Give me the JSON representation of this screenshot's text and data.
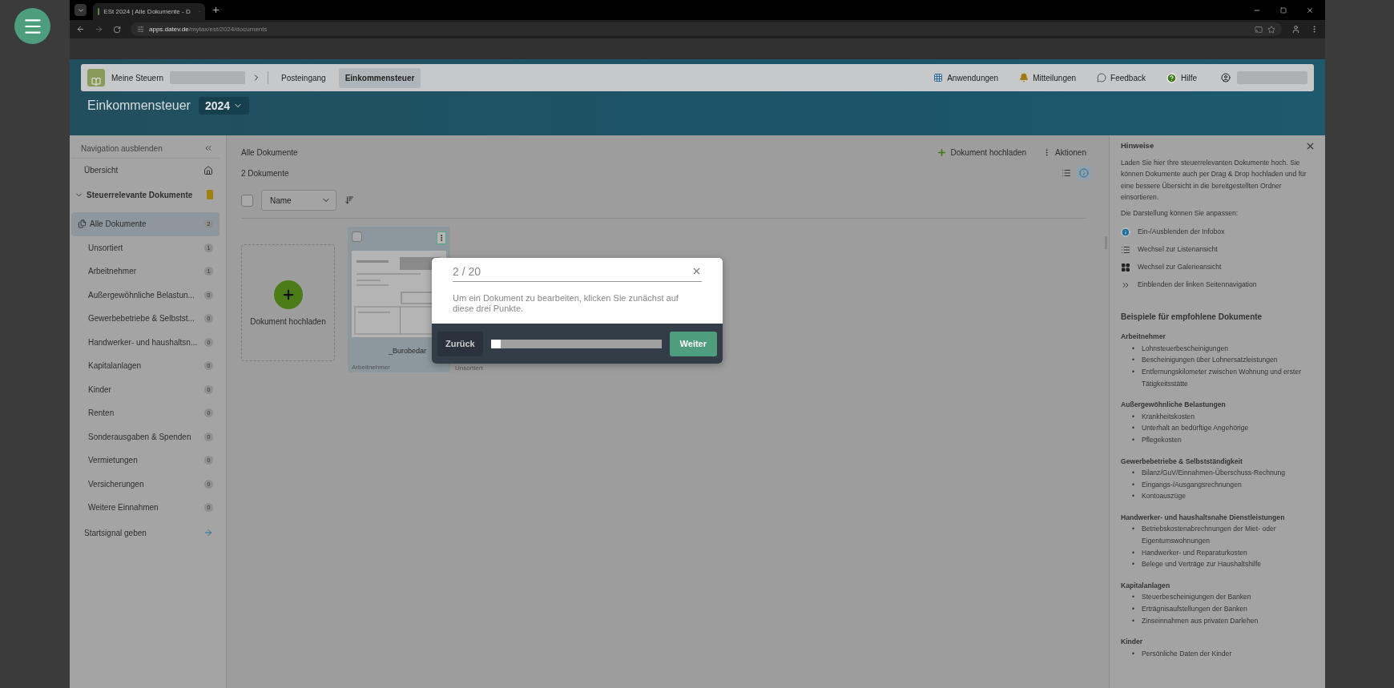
{
  "browser": {
    "tab_title": "ESt 2024 | Alle Dokumente - D",
    "url_domain": "apps.datev.de",
    "url_path": "/mytax/est/2024/documents"
  },
  "header": {
    "app_name": "Meine Steuern",
    "breadcrumbs": [
      {
        "label": "Posteingang",
        "selected": false
      },
      {
        "label": "Einkommensteuer",
        "selected": true
      }
    ],
    "actions": [
      {
        "kind": "grid",
        "label": "Anwendungen"
      },
      {
        "kind": "bell",
        "label": "Mitteilungen"
      },
      {
        "kind": "chat",
        "label": "Feedback"
      },
      {
        "kind": "help",
        "label": "Hilfe"
      }
    ]
  },
  "title": {
    "text": "Einkommensteuer",
    "year": "2024"
  },
  "sidebar": {
    "hide_label": "Navigation ausblenden",
    "overview": "Übersicht",
    "section": {
      "label": "Steuerrelevante Dokumente",
      "expanded": true
    },
    "items": [
      {
        "label": "Alle Dokumente",
        "count": "2",
        "selected": true
      },
      {
        "label": "Unsortiert",
        "count": "1",
        "selected": false
      },
      {
        "label": "Arbeitnehmer",
        "count": "1",
        "selected": false
      },
      {
        "label": "Außergewöhnliche Belastun...",
        "count": "0",
        "selected": false
      },
      {
        "label": "Gewerbebetriebe & Selbstst...",
        "count": "0",
        "selected": false
      },
      {
        "label": "Handwerker- und haushaltsn...",
        "count": "0",
        "selected": false
      },
      {
        "label": "Kapitalanlagen",
        "count": "0",
        "selected": false
      },
      {
        "label": "Kinder",
        "count": "0",
        "selected": false
      },
      {
        "label": "Renten",
        "count": "0",
        "selected": false
      },
      {
        "label": "Sonderausgaben & Spenden",
        "count": "0",
        "selected": false
      },
      {
        "label": "Vermietungen",
        "count": "0",
        "selected": false
      },
      {
        "label": "Versicherungen",
        "count": "0",
        "selected": false
      },
      {
        "label": "Weitere Einnahmen",
        "count": "0",
        "selected": false
      }
    ],
    "start": "Startsignal geben"
  },
  "main": {
    "heading": "Alle Dokumente",
    "upload": "Dokument hochladen",
    "actions": "Aktionen",
    "count_label": "2 Dokumente",
    "view_buttons": [
      {
        "kind": "list",
        "selected": false
      },
      {
        "kind": "info",
        "selected": true
      }
    ],
    "select_all_checked": false,
    "sort": "Name",
    "upload_tile": "Dokument hochladen",
    "documents": [
      {
        "name": "_Burobedar",
        "category": "Arbeitnehmer",
        "checked": false
      },
      {
        "category": "Unsortiert"
      }
    ]
  },
  "info_panel": {
    "title": "Hinweise",
    "intro": "Laden Sie hier Ihre steuerrelevanten Dokumente hoch. Sie können Dokumente auch per Drag & Drop hochladen und für eine bessere Übersicht in die bereitgestellten Ordner einsortieren.",
    "customize": "Die Darstellung können Sie anpassen:",
    "legend": [
      {
        "kind": "info",
        "text": "Ein-/Ausblenden der Infobox"
      },
      {
        "kind": "list",
        "text": "Wechsel zur Listenansicht"
      },
      {
        "kind": "gallery",
        "text": "Wechsel zur Galerieansicht"
      },
      {
        "kind": "expand",
        "text": "Einblenden der linken Seitennavigation"
      }
    ],
    "examples_title": "Beispiele für empfohlene Dokumente",
    "bullet": "•",
    "groups": [
      {
        "title": "Arbeitnehmer",
        "items": [
          "Lohnsteuerbescheinigungen",
          "Bescheinigungen über Lohnersatzleistungen",
          "Entfernungskilometer zwischen Wohnung und erster Tätigkeitsstätte"
        ]
      },
      {
        "title": "Außergewöhnliche Belastungen",
        "items": [
          "Krankheitskosten",
          "Unterhalt an bedürftige Angehörige",
          "Pflegekosten"
        ]
      },
      {
        "title": "Gewerbebetriebe & Selbstständigkeit",
        "items": [
          "Bilanz/GuV/Einnahmen-Überschuss-Rechnung",
          "Eingangs-/Ausgangsrechnungen",
          "Kontoauszüge"
        ]
      },
      {
        "title": "Handwerker- und haushaltsnahe Dienstleistungen",
        "items": [
          "Betriebskostenabrechnungen der Miet- oder Eigentumswohnungen",
          "Handwerker- und Reparaturkosten",
          "Belege und Verträge zur Haushaltshilfe"
        ]
      },
      {
        "title": "Kapitalanlagen",
        "items": [
          "Steuerbescheinigungen der Banken",
          "Erträgnisaufstellungen der Banken",
          "Zinseinnahmen aus privaten Darlehen"
        ]
      },
      {
        "title": "Kinder",
        "items": [
          "Persönliche Daten der Kinder"
        ]
      }
    ]
  },
  "tour": {
    "step": "2 / 20",
    "text": "Um ein Dokument zu bearbeiten, klicken Sie zunächst auf diese drei Punkte.",
    "back": "Zurück",
    "next": "Weiter",
    "level": 0.06
  }
}
